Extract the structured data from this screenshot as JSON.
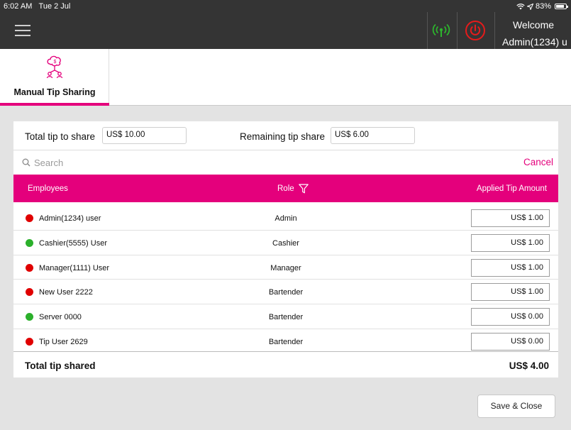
{
  "status_bar": {
    "time": "6:02 AM",
    "date": "Tue 2 Jul",
    "battery": "83%"
  },
  "header": {
    "welcome": "Welcome",
    "user": "Admin(1234) u"
  },
  "tab": {
    "label": "Manual Tip Sharing"
  },
  "tip_summary": {
    "total_label": "Total tip to share",
    "total_value": "US$ 10.00",
    "remaining_label": "Remaining tip share",
    "remaining_value": "US$ 6.00"
  },
  "search": {
    "placeholder": "Search",
    "cancel_label": "Cancel"
  },
  "table": {
    "headers": {
      "employees": "Employees",
      "role": "Role",
      "amount": "Applied Tip Amount"
    },
    "rows": [
      {
        "name": "Admin(1234) user",
        "role": "Admin",
        "amount": "US$ 1.00",
        "status": "red"
      },
      {
        "name": "Cashier(5555) User",
        "role": "Cashier",
        "amount": "US$ 1.00",
        "status": "green"
      },
      {
        "name": "Manager(1111) User",
        "role": "Manager",
        "amount": "US$ 1.00",
        "status": "red"
      },
      {
        "name": "New User 2222",
        "role": "Bartender",
        "amount": "US$ 1.00",
        "status": "red"
      },
      {
        "name": "Server 0000",
        "role": "Bartender",
        "amount": "US$ 0.00",
        "status": "green"
      },
      {
        "name": "Tip User 2629",
        "role": "Bartender",
        "amount": "US$ 0.00",
        "status": "red"
      }
    ]
  },
  "total_shared": {
    "label": "Total tip shared",
    "value": "US$ 4.00"
  },
  "save_button": "Save & Close",
  "colors": {
    "accent": "#e4007c",
    "status_red": "#e00000",
    "status_green": "#2bb02b",
    "topbar": "#343434"
  }
}
